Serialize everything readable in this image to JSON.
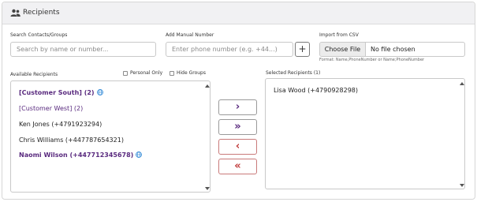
{
  "header": {
    "title": "Recipients",
    "icon": "users-icon"
  },
  "search": {
    "label": "Search Contacts/Groups",
    "placeholder": "Search by name or number..."
  },
  "manual": {
    "label": "Add Manual Number",
    "placeholder": "Enter phone number (e.g. +44...)",
    "add_label": "+"
  },
  "csv": {
    "label": "Import from CSV",
    "button_label": "Choose File",
    "status": "No file chosen",
    "format_hint": "Format: Name,PhoneNumber or Name;PhoneNumber"
  },
  "available": {
    "label": "Available Recipients",
    "filters": [
      {
        "label": "Personal Only",
        "checked": false
      },
      {
        "label": "Hide Groups",
        "checked": false
      }
    ],
    "items": [
      {
        "text": "[Customer South] (2)",
        "type": "group",
        "globe": true,
        "bold": true
      },
      {
        "text": "[Customer West] (2)",
        "type": "group",
        "globe": false,
        "bold": false
      },
      {
        "text": "Ken Jones (+4791923294)",
        "type": "contact",
        "globe": false,
        "bold": false
      },
      {
        "text": "Chris Williams (+447787654321)",
        "type": "contact",
        "globe": false,
        "bold": false
      },
      {
        "text": "Naomi Wilson (+447712345678)",
        "type": "contact",
        "globe": true,
        "bold": true
      }
    ]
  },
  "selected": {
    "label": "Selected Recipients (1)",
    "items": [
      {
        "text": "Lisa Wood (+4790928298)"
      }
    ]
  },
  "transfer": {
    "add_one": "›",
    "add_all": "»",
    "remove_one": "‹",
    "remove_all": "«"
  },
  "colors": {
    "group": "#5a2b7f",
    "remove": "#c03a3a",
    "globe": "#3b8fd9"
  }
}
